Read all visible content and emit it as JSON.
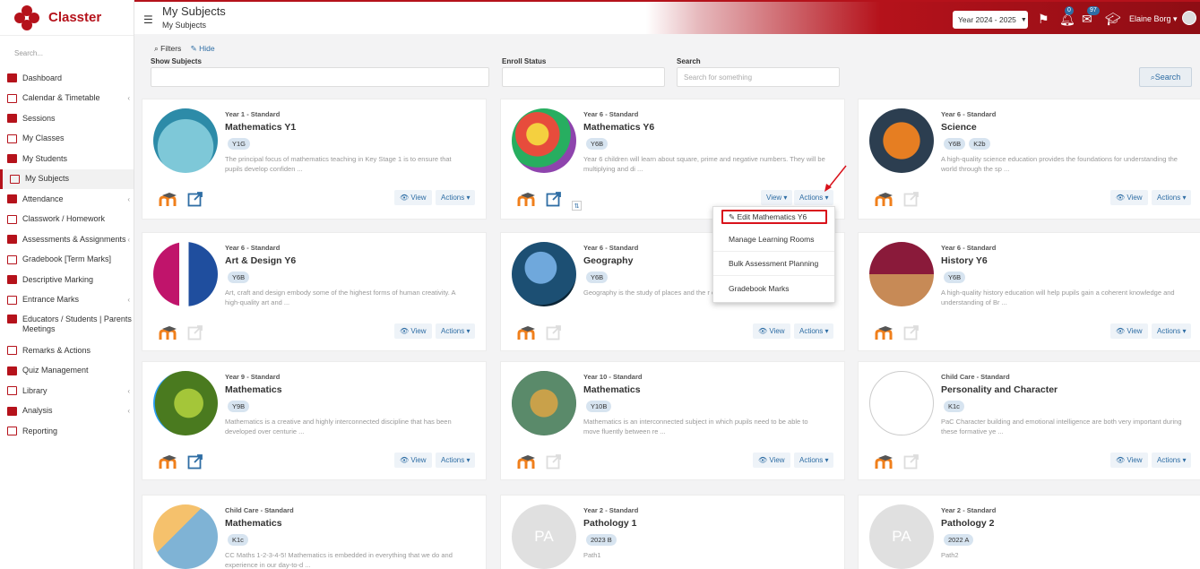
{
  "brand": {
    "name": "Classter"
  },
  "sidebar": {
    "search_placeholder": "Search...",
    "items": [
      {
        "label": "Dashboard",
        "icon": "monitor-icon"
      },
      {
        "label": "Calendar & Timetable",
        "icon": "calendar-icon",
        "arrow": "‹"
      },
      {
        "label": "Sessions",
        "icon": "sessions-icon"
      },
      {
        "label": "My Classes",
        "icon": "classes-icon"
      },
      {
        "label": "My Students",
        "icon": "students-icon"
      },
      {
        "label": "My Subjects",
        "icon": "book-icon"
      },
      {
        "label": "Attendance",
        "icon": "attendance-icon",
        "arrow": "‹"
      },
      {
        "label": "Classwork / Homework",
        "icon": "list-icon"
      },
      {
        "label": "Assessments & Assignments",
        "icon": "pencil-icon",
        "arrow": "‹"
      },
      {
        "label": "Gradebook [Term Marks]",
        "icon": "gradebook-icon"
      },
      {
        "label": "Descriptive Marking",
        "icon": "pen-icon"
      },
      {
        "label": "Entrance Marks",
        "icon": "doc-icon",
        "arrow": "‹"
      },
      {
        "label": "Educators / Students | Parents Meetings",
        "icon": "meeting-icon",
        "arrow": "‹"
      },
      {
        "label": "Remarks & Actions",
        "icon": "remarks-icon"
      },
      {
        "label": "Quiz Management",
        "icon": "quiz-icon"
      },
      {
        "label": "Library",
        "icon": "library-icon",
        "arrow": "‹"
      },
      {
        "label": "Analysis",
        "icon": "chart-icon",
        "arrow": "‹"
      },
      {
        "label": "Reporting",
        "icon": "printer-icon"
      }
    ]
  },
  "header": {
    "title": "My Subjects",
    "subtitle": "My Subjects",
    "year_select": "Year 2024 - 2025",
    "notifications_count": "0",
    "messages_count": "97",
    "user_name": "Elaine Borg"
  },
  "filters": {
    "toggle_label": "Filters",
    "hide_label": "Hide",
    "show_subjects_label": "Show Subjects",
    "enroll_status_label": "Enroll Status",
    "search_label": "Search",
    "search_placeholder": "Search for something",
    "search_button": "Search"
  },
  "buttons": {
    "view": "View",
    "actions": "Actions"
  },
  "cards": [
    {
      "meta": "Year 1 - Standard",
      "title": "Mathematics Y1",
      "tags": [
        "Y1G"
      ],
      "desc": "The principal focus of mathematics teaching in Key Stage 1 is to ensure that pupils develop confiden ..."
    },
    {
      "meta": "Year 6 - Standard",
      "title": "Mathematics Y6",
      "tags": [
        "Y6B"
      ],
      "desc": "Year 6 children will learn about square, prime and negative numbers. They will be multiplying and di ..."
    },
    {
      "meta": "Year 6 - Standard",
      "title": "Science",
      "tags": [
        "Y6B",
        "K2b"
      ],
      "desc": "A high-quality science education provides the foundations for understanding the world through the sp ..."
    },
    {
      "meta": "Year 6 - Standard",
      "title": "Art & Design Y6",
      "tags": [
        "Y6B"
      ],
      "desc": "Art, craft and design embody some of the highest forms of human creativity. A high-quality art and ..."
    },
    {
      "meta": "Year 6 - Standard",
      "title": "Geography",
      "tags": [
        "Y6B"
      ],
      "desc": "Geography is the study of places and the r environments. Geogra ..."
    },
    {
      "meta": "Year 6 - Standard",
      "title": "History Y6",
      "tags": [
        "Y6B"
      ],
      "desc": "A high-quality history education will help pupils gain a coherent knowledge and understanding of Br ..."
    },
    {
      "meta": "Year 9 - Standard",
      "title": "Mathematics",
      "tags": [
        "Y9B"
      ],
      "desc": "Mathematics is a creative and highly interconnected discipline that has been developed over centurie ..."
    },
    {
      "meta": "Year 10 - Standard",
      "title": "Mathematics",
      "tags": [
        "Y10B"
      ],
      "desc": "Mathematics is an interconnected subject in which pupils need to be able to move fluently between re ..."
    },
    {
      "meta": "Child Care - Standard",
      "title": "Personality and Character",
      "tags": [
        "K1c"
      ],
      "desc": "PaC Character building and emotional intelligence are both very important during these formative ye ..."
    },
    {
      "meta": "Child Care - Standard",
      "title": "Mathematics",
      "tags": [
        "K1c"
      ],
      "desc": "CC Maths 1-2-3-4-5! Mathematics is embedded in everything that we do and experience in our day-to-d ..."
    },
    {
      "meta": "Year 2 - Standard",
      "title": "Pathology 1",
      "tags": [
        "2023 B"
      ],
      "desc": "Path1",
      "initials": "PA"
    },
    {
      "meta": "Year 2 - Standard",
      "title": "Pathology 2",
      "tags": [
        "2022 A"
      ],
      "desc": "Path2",
      "initials": "PA"
    }
  ],
  "dropdown": {
    "items": [
      "Edit Mathematics Y6",
      "Manage Learning Rooms",
      "Bulk Assessment Planning",
      "Gradebook Marks"
    ]
  },
  "colors": {
    "brand": "#b5121b",
    "link": "#2e6da4",
    "tag_bg": "#d7e4f0"
  }
}
